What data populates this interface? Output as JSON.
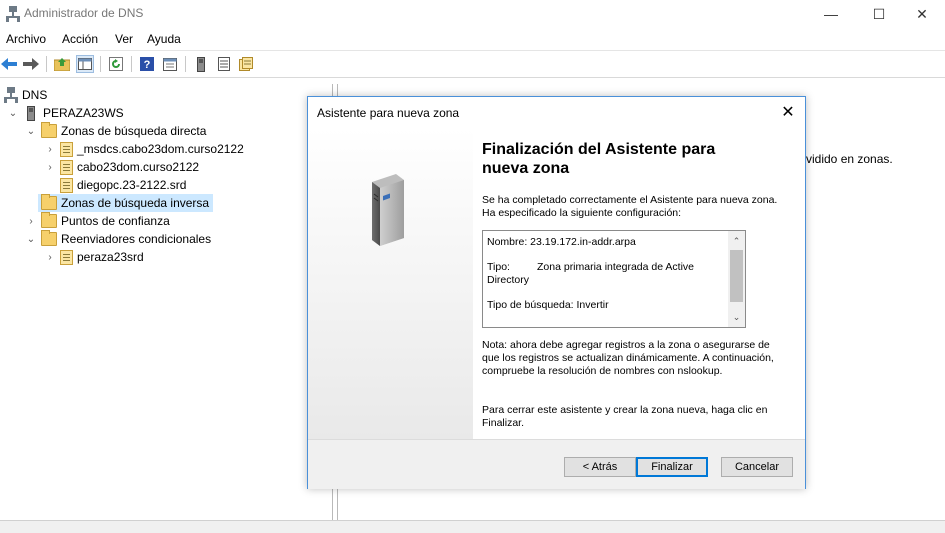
{
  "window": {
    "title": "Administrador de DNS",
    "controls": {
      "minimize": "—",
      "maximize": "☐",
      "close": "✕"
    }
  },
  "menu": [
    "Archivo",
    "Acción",
    "Ver",
    "Ayuda"
  ],
  "toolbar_icons": [
    "back-arrow-icon",
    "forward-arrow-icon",
    "up-folder-icon",
    "show-hide-console-tree-icon",
    "refresh-icon",
    "help-icon",
    "properties-icon",
    "server-icon",
    "list-icon",
    "zone-icon"
  ],
  "tree": [
    {
      "label": "DNS",
      "level": 0,
      "icon": "dns-icon",
      "expander": ""
    },
    {
      "label": "PERAZA23WS",
      "level": 1,
      "icon": "server-icon",
      "expander": "down"
    },
    {
      "label": "Zonas de búsqueda directa",
      "level": 2,
      "icon": "folder-icon",
      "expander": "down"
    },
    {
      "label": "_msdcs.cabo23dom.curso2122",
      "level": 3,
      "icon": "zone-icon",
      "expander": "right"
    },
    {
      "label": "cabo23dom.curso2122",
      "level": 3,
      "icon": "zone-icon",
      "expander": "right"
    },
    {
      "label": "diegopc.23-2122.srd",
      "level": 3,
      "icon": "zone-icon",
      "expander": ""
    },
    {
      "label": "Zonas de búsqueda inversa",
      "level": 2,
      "icon": "folder-icon",
      "expander": "",
      "selected": true
    },
    {
      "label": "Puntos de confianza",
      "level": 2,
      "icon": "folder-icon",
      "expander": "right"
    },
    {
      "label": "Reenviadores condicionales",
      "level": 2,
      "icon": "folder-icon",
      "expander": "down"
    },
    {
      "label": "peraza23srd",
      "level": 3,
      "icon": "zone-icon",
      "expander": "right"
    }
  ],
  "right_pane_text": "vidido en zonas.",
  "dialog": {
    "title": "Asistente para nueva zona",
    "close": "✕",
    "heading_line1": "Finalización del Asistente para",
    "heading_line2": "nueva zona",
    "intro": "Se ha completado correctamente el Asistente para nueva zona. Ha especificado la siguiente configuración:",
    "summary": {
      "name_line": "Nombre:  23.19.172.in-addr.arpa",
      "type_label": "Tipo:",
      "type_value_1": "Zona primaria integrada de Active",
      "type_value_2": "Directory",
      "lookup_line": "Tipo de búsqueda:  Invertir"
    },
    "note": "Nota: ahora debe agregar registros a la zona o asegurarse de que los registros se actualizan dinámicamente. A continuación, compruebe la resolución de nombres con nslookup.",
    "finish_text": "Para cerrar este asistente y crear la zona nueva, haga clic en Finalizar.",
    "buttons": {
      "back": "< Atrás",
      "finish": "Finalizar",
      "cancel": "Cancelar"
    }
  },
  "colors": {
    "selection": "#cce8ff",
    "accent": "#0078d7",
    "folder": "#f6d06b"
  }
}
